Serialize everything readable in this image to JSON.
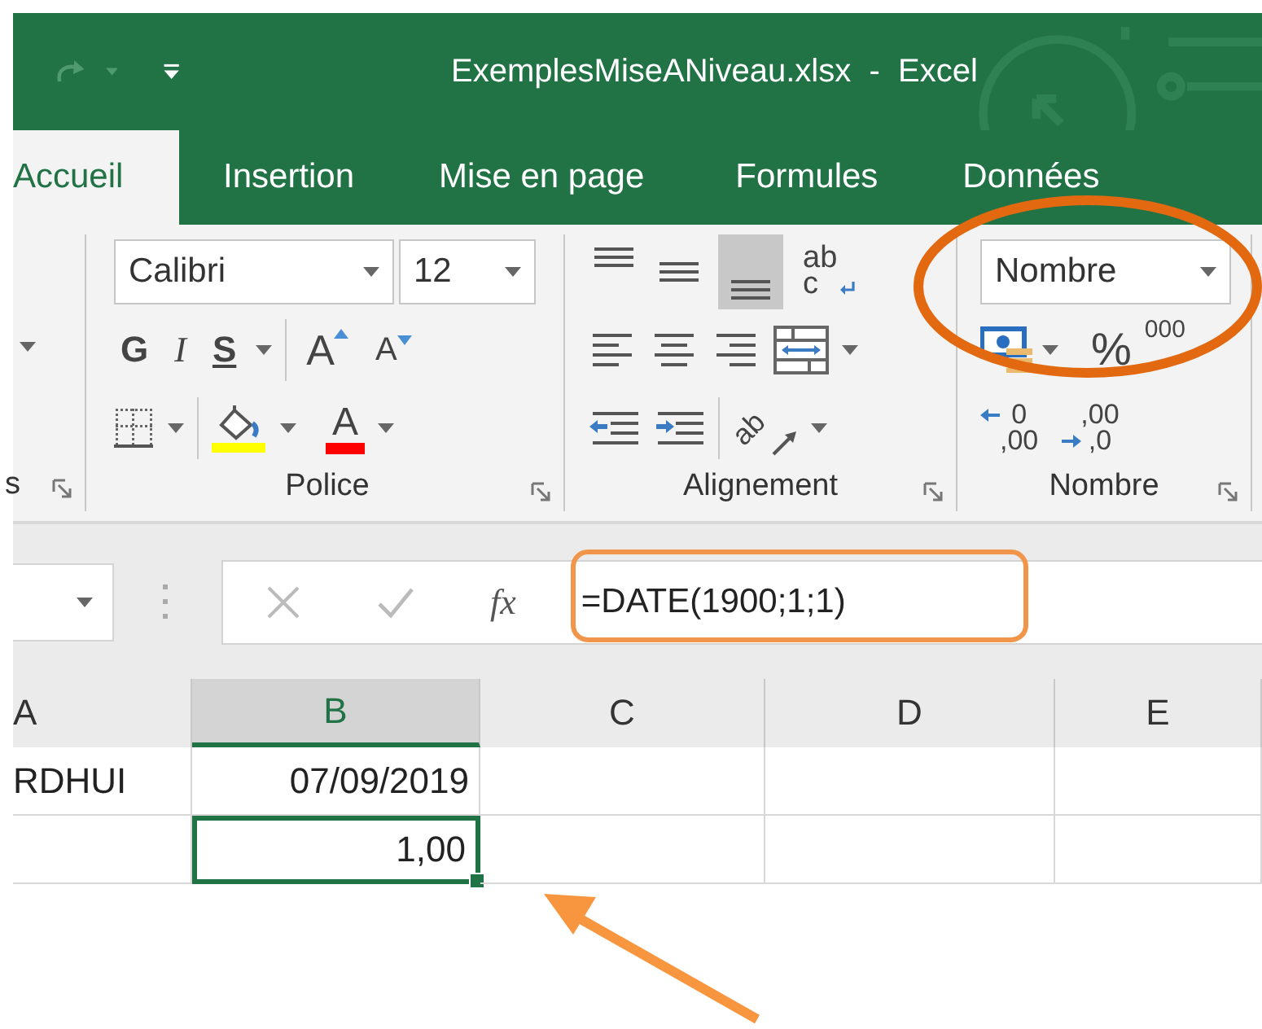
{
  "title_bar": {
    "title": "ExemplesMiseANiveau.xlsx  -  Excel"
  },
  "tabs": [
    {
      "label": "Accueil",
      "selected": true
    },
    {
      "label": "Insertion",
      "selected": false
    },
    {
      "label": "Mise en page",
      "selected": false
    },
    {
      "label": "Formules",
      "selected": false
    },
    {
      "label": "Données",
      "selected": false
    }
  ],
  "ribbon": {
    "groups": [
      {
        "kind": "clipped",
        "label": "s"
      },
      {
        "kind": "font",
        "label": "Police",
        "font_name": "Calibri",
        "font_size": "12",
        "bold": "G",
        "italic": "I",
        "underline": "S",
        "grow": "A",
        "shrink": "A",
        "font_color": "A"
      },
      {
        "kind": "alignment",
        "label": "Alignement",
        "vertical_align": [
          {
            "selected": false
          },
          {
            "selected": false
          },
          {
            "selected": true
          }
        ],
        "wrap_top": "ab",
        "wrap_bottom": "c",
        "orientation": "ab"
      },
      {
        "kind": "number",
        "label": "Nombre",
        "format": "Nombre",
        "percent": "%",
        "thousands": "000",
        "increase_decimal": [
          "0",
          ",00"
        ],
        "decrease_decimal": [
          ",00",
          ",0"
        ]
      }
    ]
  },
  "formula_bar": {
    "function_label": "fx",
    "formula": "=DATE(1900;1;1)"
  },
  "sheet": {
    "columns": [
      {
        "label": "A",
        "selected": false
      },
      {
        "label": "B",
        "selected": true
      },
      {
        "label": "C",
        "selected": false
      },
      {
        "label": "D",
        "selected": false
      },
      {
        "label": "E",
        "selected": false
      }
    ],
    "rows": [
      {
        "cells": [
          {
            "kind": "text",
            "value": "RDHUI",
            "selected": false
          },
          {
            "kind": "number",
            "value": "07/09/2019",
            "selected": false
          },
          {
            "kind": "empty",
            "selected": false
          },
          {
            "kind": "empty",
            "selected": false
          },
          {
            "kind": "empty",
            "selected": false
          }
        ]
      },
      {
        "cells": [
          {
            "kind": "empty",
            "selected": false
          },
          {
            "kind": "number",
            "value": "1,00",
            "selected": true
          },
          {
            "kind": "empty",
            "selected": false
          },
          {
            "kind": "empty",
            "selected": false
          },
          {
            "kind": "empty",
            "selected": false
          }
        ]
      }
    ]
  },
  "annotations": [
    {
      "kind": "ellipse"
    },
    {
      "kind": "frame"
    },
    {
      "kind": "arrow"
    }
  ]
}
